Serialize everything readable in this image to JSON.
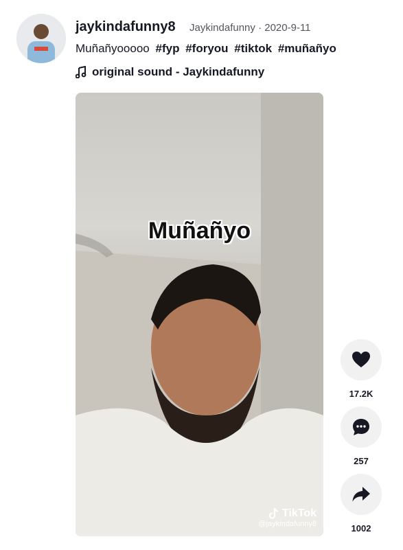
{
  "post": {
    "username": "jaykindafunny8",
    "nickname": "Jaykindafunny",
    "separator": " · ",
    "date": "2020-9-11",
    "caption_text": "Muñañyooooo",
    "hashtags": [
      "#fyp",
      "#foryou",
      "#tiktok",
      "#muñañyo"
    ],
    "sound": "original sound - Jaykindafunny"
  },
  "video": {
    "overlay_text": "Muñañyo",
    "watermark_brand": "TikTok",
    "watermark_handle": "@jaykindafunny8"
  },
  "actions": {
    "like_count": "17.2K",
    "comment_count": "257",
    "share_count": "1002"
  },
  "icons": {
    "like": "heart-icon",
    "comment": "comment-icon",
    "share": "share-icon",
    "music": "music-note-icon"
  }
}
